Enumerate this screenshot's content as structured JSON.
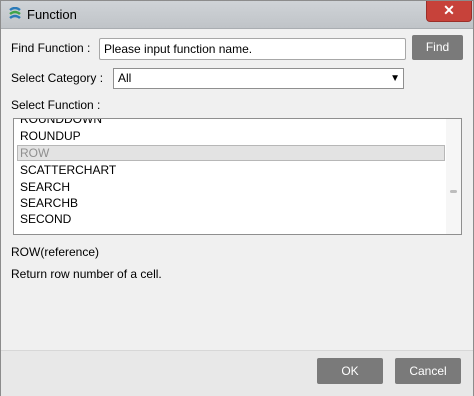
{
  "window": {
    "title": "Function",
    "close_glyph": "✕"
  },
  "find": {
    "label": "Find Function :",
    "value": "Please input function name.",
    "button": "Find"
  },
  "category": {
    "label": "Select Category :",
    "value": "All",
    "arrow": "▼"
  },
  "functions": {
    "label": "Select Function :",
    "items": [
      "ROUNDDOWN",
      "ROUNDUP",
      "ROW",
      "SCATTERCHART",
      "SEARCH",
      "SEARCHB",
      "SECOND"
    ],
    "selected": "ROW"
  },
  "detail": {
    "signature": "ROW(reference)",
    "description": "Return row number of a cell."
  },
  "buttons": {
    "ok": "OK",
    "cancel": "Cancel"
  },
  "colors": {
    "button_bg": "#7a7a7a",
    "close_bg": "#c7423a",
    "titlebar": "#c6cacd"
  }
}
